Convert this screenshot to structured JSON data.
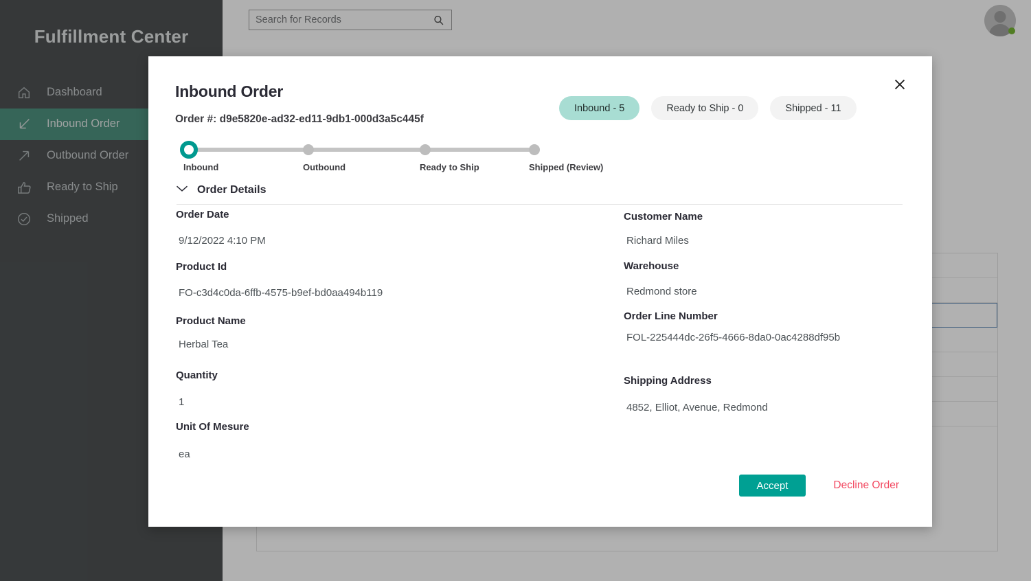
{
  "app": {
    "brand": "Fulfillment Center"
  },
  "search": {
    "placeholder": "Search for Records",
    "value": "Search for Records",
    "icon": "search-icon"
  },
  "account": {
    "avatar_icon": "avatar-icon",
    "presence_color": "#5aa60c"
  },
  "sidebar": {
    "items": [
      {
        "label": "Dashboard",
        "icon": "home-icon",
        "active": false
      },
      {
        "label": "Inbound Order",
        "icon": "arrow-inbound-icon",
        "active": true
      },
      {
        "label": "Outbound Order",
        "icon": "arrow-outbound-icon",
        "active": false
      },
      {
        "label": "Ready to Ship",
        "icon": "thumbs-up-icon",
        "active": false
      },
      {
        "label": "Shipped",
        "icon": "check-circle-icon",
        "active": false
      }
    ]
  },
  "modal": {
    "title": "Inbound Order",
    "order_number_label": "Order #: d9e5820e-ad32-ed11-9db1-000d3a5c445f",
    "close_icon": "close-icon",
    "pills": [
      {
        "label": "Inbound - 5",
        "active": true
      },
      {
        "label": "Ready to Ship - 0",
        "active": false
      },
      {
        "label": "Shipped - 11",
        "active": false
      }
    ],
    "stepper": {
      "steps": [
        {
          "label": "Inbound",
          "state": "current"
        },
        {
          "label": "Outbound",
          "state": "pending"
        },
        {
          "label": "Ready to Ship",
          "state": "pending"
        },
        {
          "label": "Shipped (Review)",
          "state": "pending"
        }
      ],
      "active_color": "#00998f",
      "track_color": "#c4c4c4"
    },
    "details": {
      "section_title": "Order Details",
      "expand_icon": "chevron-down-icon",
      "left_fields": [
        {
          "label": "Order Date",
          "value": "9/12/2022 4:10 PM"
        },
        {
          "label": "Product Id",
          "value": "FO-c3d4c0da-6ffb-4575-b9ef-bd0aa494b119"
        },
        {
          "label": "Product Name",
          "value": "Herbal Tea"
        },
        {
          "label": "Quantity",
          "value": "1"
        },
        {
          "label": "Unit Of Mesure",
          "value": "ea"
        }
      ],
      "right_fields": [
        {
          "label": "Customer Name",
          "value": "Richard Miles"
        },
        {
          "label": "Warehouse",
          "value": "Redmond store"
        },
        {
          "label": "Order Line Number",
          "value": "FOL-225444dc-26f5-4666-8da0-0ac4288df95b"
        },
        {
          "label": "Shipping Address",
          "value": "4852, Elliot, Avenue, Redmond"
        }
      ]
    },
    "actions": {
      "accept_label": "Accept",
      "decline_label": "Decline Order",
      "accept_color": "#00a093",
      "decline_color": "#f2475f"
    }
  },
  "theme": {
    "sidebar_bg": "#2b2f31",
    "sidebar_active": "#2c7c67",
    "accent_teal": "#00a093",
    "pill_active": "#a8ddd3"
  }
}
